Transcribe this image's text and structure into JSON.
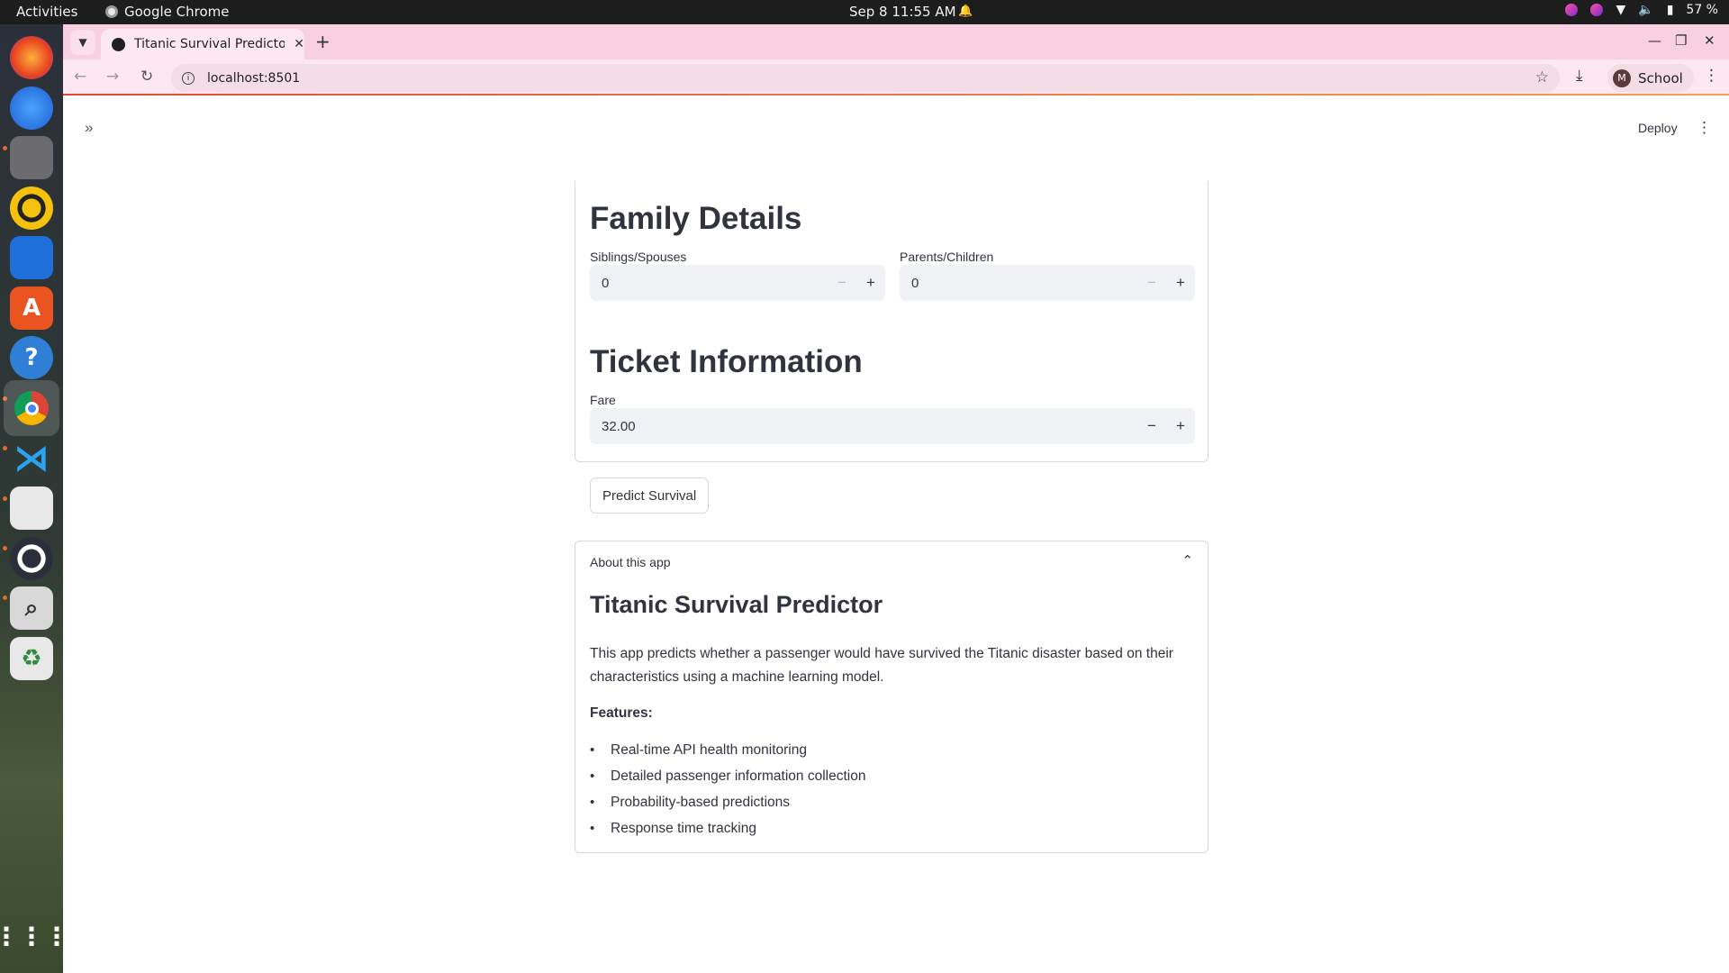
{
  "system": {
    "activities": "Activities",
    "app_name": "Google Chrome",
    "clock": "Sep 8  11:55 AM",
    "battery": "57 %"
  },
  "browser": {
    "tab_title": "Titanic Survival Predictor",
    "url": "localhost:8501",
    "profile_initial": "M",
    "profile_name": "School"
  },
  "app": {
    "deploy_label": "Deploy",
    "family": {
      "heading": "Family Details",
      "siblings_label": "Siblings/Spouses",
      "siblings_value": "0",
      "parents_label": "Parents/Children",
      "parents_value": "0"
    },
    "ticket": {
      "heading": "Ticket Information",
      "fare_label": "Fare",
      "fare_value": "32.00"
    },
    "predict_button": "Predict Survival",
    "about": {
      "header": "About this app",
      "title": "Titanic Survival Predictor",
      "description": "This app predicts whether a passenger would have survived the Titanic disaster based on their characteristics using a machine learning model.",
      "features_label": "Features:",
      "features": [
        "Real-time API health monitoring",
        "Detailed passenger information collection",
        "Probability-based predictions",
        "Response time tracking"
      ]
    }
  }
}
